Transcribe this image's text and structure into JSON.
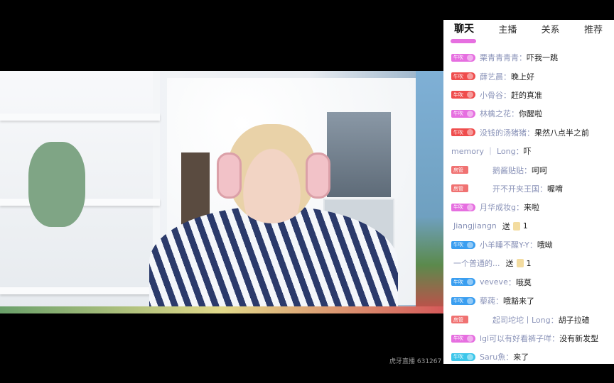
{
  "watermark": "虎牙直播 631267",
  "chat": {
    "tabs": [
      "聊天",
      "主播",
      "关系",
      "推荐"
    ],
    "colors": {
      "pink": "#e66fe0",
      "red": "#ef4d4d",
      "blue": "#3a9ef0",
      "cyan": "#3cc6ea",
      "admin": "#f07272"
    },
    "rows": [
      {
        "type": "msg",
        "badge": "牛吹",
        "color": "#e66fe0",
        "name": "栗青青青青",
        "msg": "吓我一跳"
      },
      {
        "type": "msg",
        "badge": "牛吹",
        "color": "#ef4d4d",
        "name": "薛艺晨",
        "msg": "晚上好"
      },
      {
        "type": "msg",
        "badge": "牛吹",
        "color": "#ef4d4d",
        "name": "小骨谷",
        "msg": "赶的真准"
      },
      {
        "type": "msg",
        "badge": "牛吹",
        "color": "#e66fe0",
        "name": "林檎之花",
        "msg": "你醒啦"
      },
      {
        "type": "msg",
        "badge": "牛吹",
        "color": "#ef4d4d",
        "name": "没钱的汤猪猪",
        "msg": "果然八点半之前"
      },
      {
        "type": "msg",
        "badge": "",
        "color": "",
        "name": "memory ｜ Long",
        "msg": "吓"
      },
      {
        "type": "admin",
        "badge": "房管",
        "color": "#f07272",
        "name": "鹅酱贴贴",
        "msg": "呵呵"
      },
      {
        "type": "admin",
        "badge": "房管",
        "color": "#f07272",
        "name": "开不开夹王国",
        "msg": "喔唷"
      },
      {
        "type": "msg",
        "badge": "牛吹",
        "color": "#e66fe0",
        "name": "月华成妆g",
        "msg": "来啦"
      },
      {
        "type": "gift",
        "name": "Jiangjiangn",
        "action": "送",
        "count": "1"
      },
      {
        "type": "msg",
        "badge": "牛吹",
        "color": "#3a9ef0",
        "name": "小羊睡不醒Y-Y",
        "msg": "哦呦"
      },
      {
        "type": "gift",
        "name": "一个普通的...",
        "action": "送",
        "count": "1"
      },
      {
        "type": "msg",
        "badge": "牛吹",
        "color": "#3a9ef0",
        "name": "veveve",
        "msg": "哦莫"
      },
      {
        "type": "msg",
        "badge": "牛吹",
        "color": "#3a9ef0",
        "name": "藜莼",
        "msg": "哦豁来了"
      },
      {
        "type": "admin",
        "badge": "房管",
        "color": "#f07272",
        "name": "起司坨坨丨Long",
        "msg": "胡子拉碴"
      },
      {
        "type": "msg",
        "badge": "牛吹",
        "color": "#e66fe0",
        "name": "lgl可以有好看裤子咩",
        "msg": "没有新发型"
      },
      {
        "type": "msg",
        "badge": "牛吹",
        "color": "#3cc6ea",
        "name": "Saru魚",
        "msg": "来了"
      }
    ]
  }
}
